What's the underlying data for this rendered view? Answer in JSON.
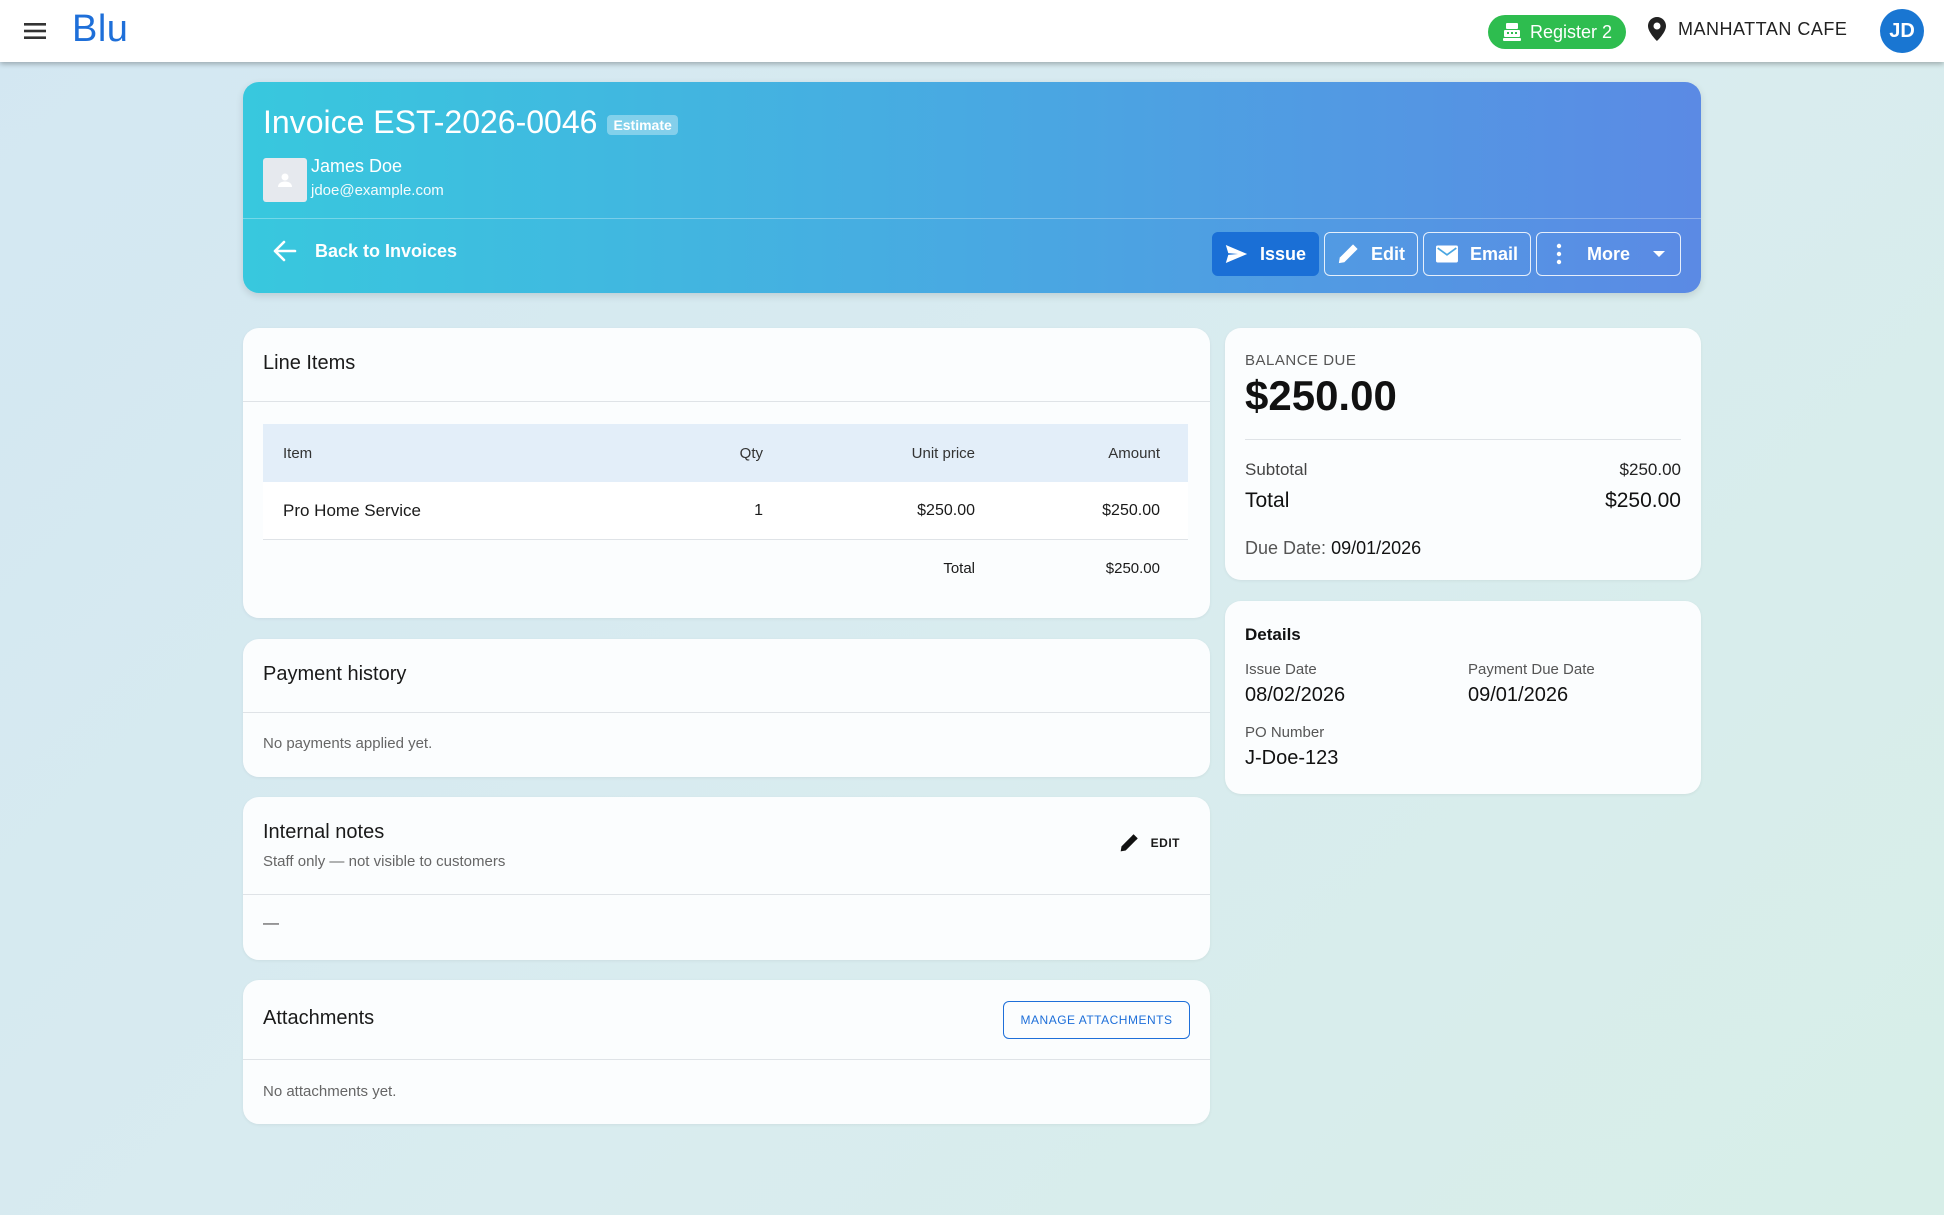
{
  "topbar": {
    "brand": "Blu",
    "register_label": "Register 2",
    "location": "MANHATTAN CAFE",
    "user_initials": "JD"
  },
  "invoice": {
    "title": "Invoice EST-2026-0046",
    "badge": "Estimate",
    "customer_name": "James Doe",
    "customer_email": "jdoe@example.com",
    "back_label": "Back to Invoices",
    "actions": {
      "issue": "Issue",
      "edit": "Edit",
      "email": "Email",
      "more": "More"
    }
  },
  "line_items": {
    "title": "Line Items",
    "columns": {
      "item": "Item",
      "qty": "Qty",
      "unit_price": "Unit price",
      "amount": "Amount"
    },
    "rows": [
      {
        "item": "Pro Home Service",
        "qty": "1",
        "unit_price": "$250.00",
        "amount": "$250.00"
      }
    ],
    "total_label": "Total",
    "total_value": "$250.00"
  },
  "payment_history": {
    "title": "Payment history",
    "empty": "No payments applied yet."
  },
  "internal_notes": {
    "title": "Internal notes",
    "subtitle": "Staff only — not visible to customers",
    "edit_label": "EDIT",
    "content": "—"
  },
  "attachments": {
    "title": "Attachments",
    "manage_label": "MANAGE ATTACHMENTS",
    "empty": "No attachments yet."
  },
  "balance": {
    "label": "BALANCE DUE",
    "amount": "$250.00",
    "subtotal_label": "Subtotal",
    "subtotal_value": "$250.00",
    "total_label": "Total",
    "total_value": "$250.00",
    "due_label": "Due Date:",
    "due_value": "09/01/2026"
  },
  "details": {
    "title": "Details",
    "issue_date_label": "Issue Date",
    "issue_date_value": "08/02/2026",
    "payment_due_label": "Payment Due Date",
    "payment_due_value": "09/01/2026",
    "po_label": "PO Number",
    "po_value": "J-Doe-123"
  },
  "colors": {
    "brand": "#1e6fd9",
    "register_green": "#2ebd4f",
    "primary_button": "#1a6fd6",
    "hero_gradient_start": "#38c8de",
    "hero_gradient_end": "#5b8ae4"
  },
  "icons": [
    "menu-icon",
    "cash-register-icon",
    "location-pin-icon",
    "person-icon",
    "arrow-left-icon",
    "send-icon",
    "pencil-icon",
    "mail-icon",
    "more-vert-icon",
    "chevron-down-icon"
  ]
}
